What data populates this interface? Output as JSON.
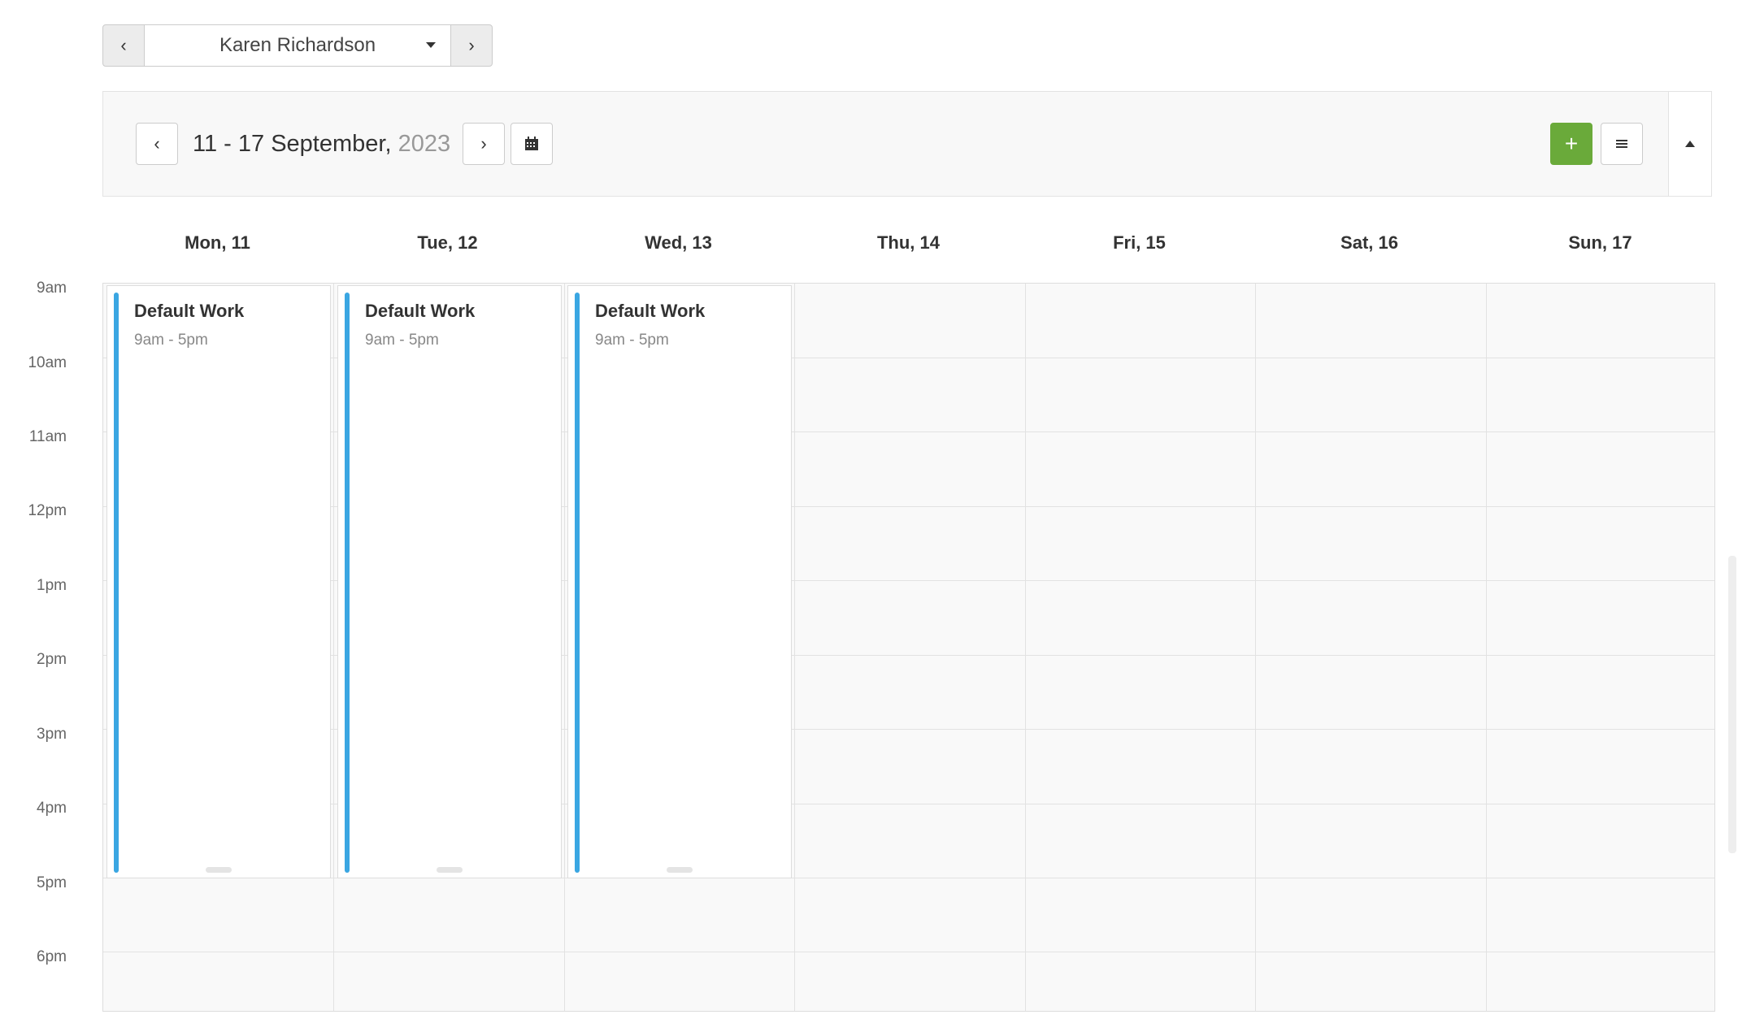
{
  "person_selector": {
    "name": "Karen Richardson",
    "prev_icon": "chevron-left-icon",
    "next_icon": "chevron-right-icon",
    "dropdown_icon": "caret-down-icon"
  },
  "week_toolbar": {
    "range": "11 - 17 September,",
    "year": "2023",
    "prev_icon": "chevron-left-icon",
    "next_icon": "chevron-right-icon",
    "calendar_icon": "calendar-icon",
    "add_label": "+",
    "menu_icon": "hamburger-menu-icon",
    "collapse_icon": "caret-up-icon"
  },
  "days": [
    "Mon, 11",
    "Tue, 12",
    "Wed, 13",
    "Thu, 14",
    "Fri, 15",
    "Sat, 16",
    "Sun, 17"
  ],
  "hours": [
    "9am",
    "10am",
    "11am",
    "12pm",
    "1pm",
    "2pm",
    "3pm",
    "4pm",
    "5pm",
    "6pm"
  ],
  "events": [
    {
      "title": "Default Work",
      "time": "9am - 5pm",
      "day": 0
    },
    {
      "title": "Default Work",
      "time": "9am - 5pm",
      "day": 1
    },
    {
      "title": "Default Work",
      "time": "9am - 5pm",
      "day": 2
    }
  ],
  "colors": {
    "accent_add": "#6aaa3a",
    "event_bar": "#3aa6e2"
  }
}
